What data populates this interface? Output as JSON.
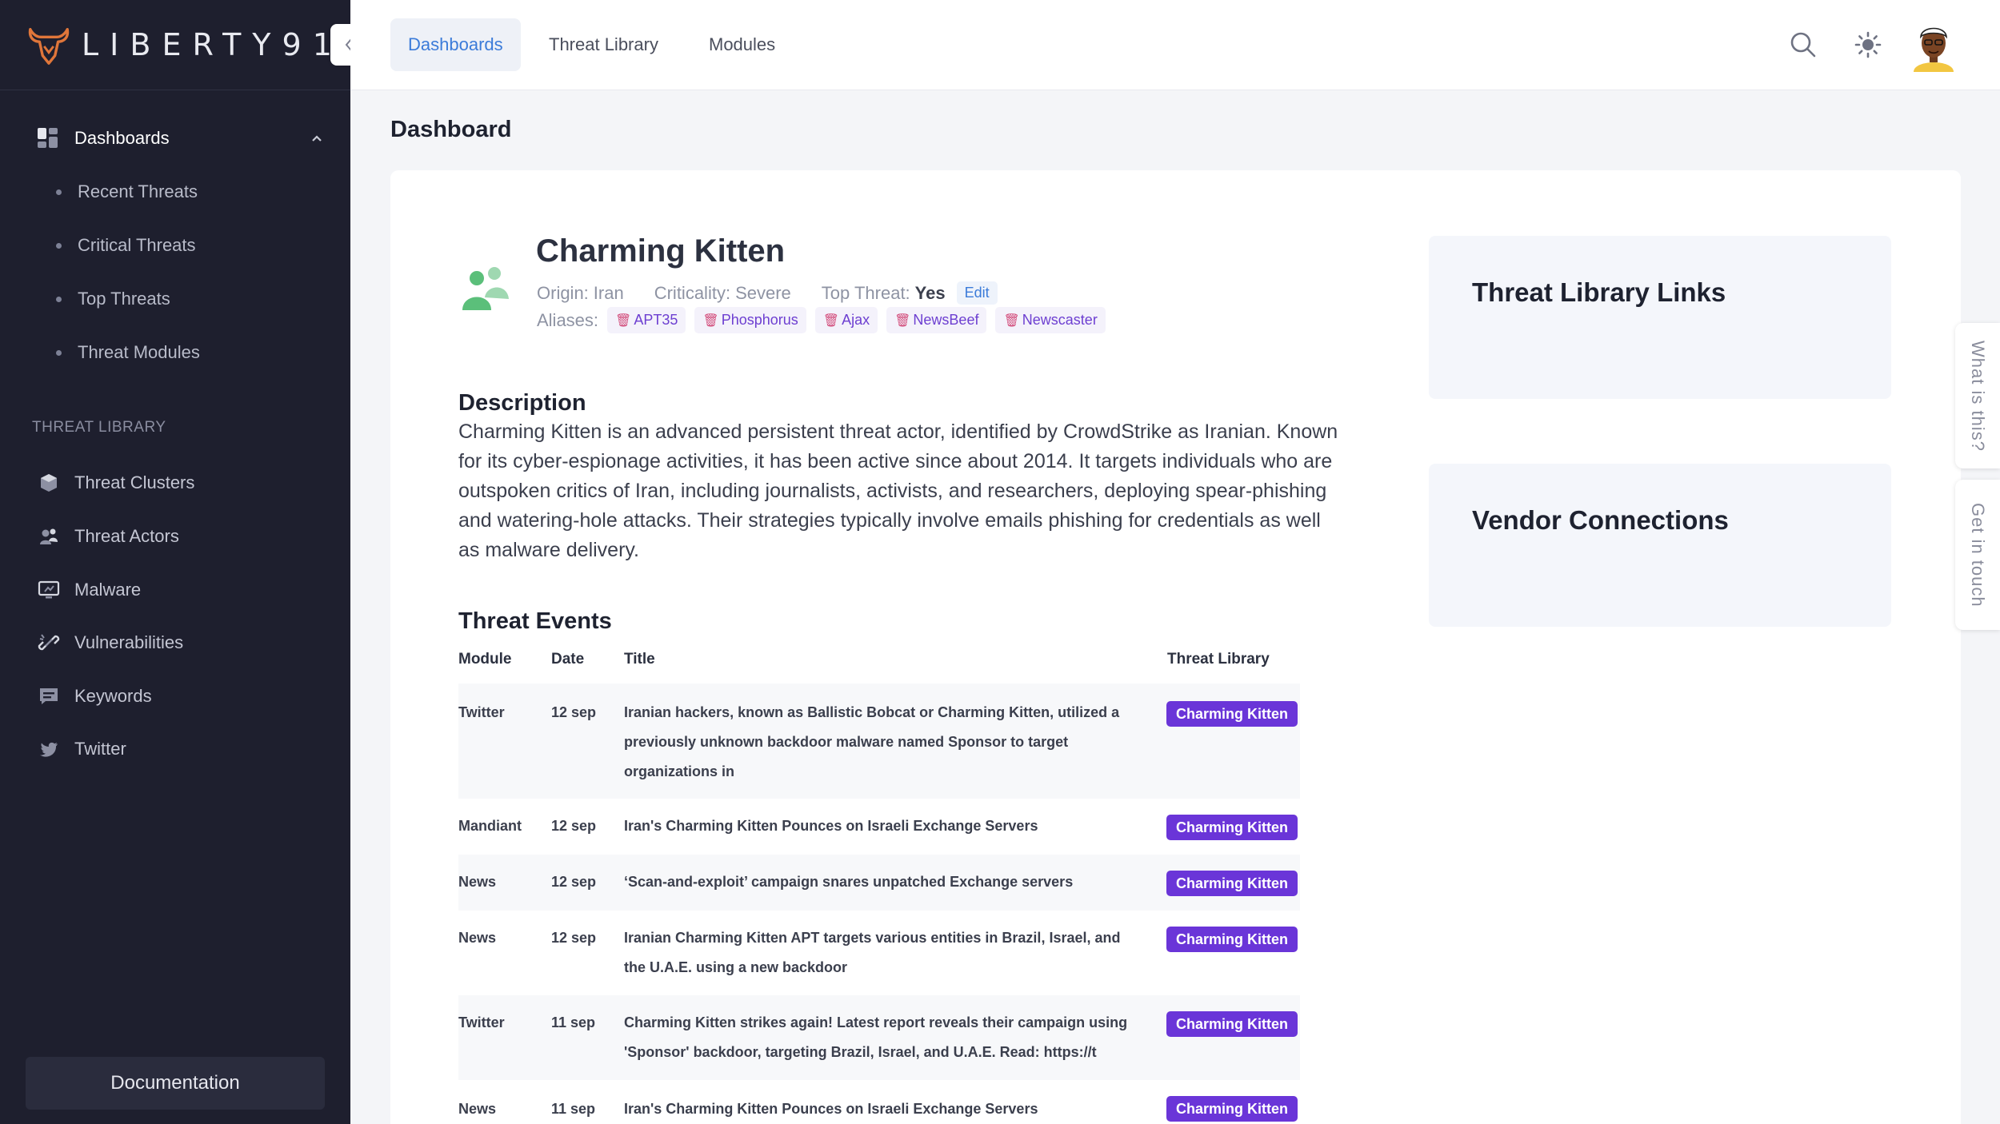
{
  "brand": {
    "name": "LIBERTY91"
  },
  "sidebar": {
    "dashboards_label": "Dashboards",
    "sub_items": [
      {
        "label": "Recent Threats"
      },
      {
        "label": "Critical Threats"
      },
      {
        "label": "Top Threats"
      },
      {
        "label": "Threat Modules"
      }
    ],
    "section_label": "THREAT LIBRARY",
    "library_items": [
      {
        "label": "Threat Clusters",
        "icon": "cube-icon"
      },
      {
        "label": "Threat Actors",
        "icon": "people-icon"
      },
      {
        "label": "Malware",
        "icon": "monitor-icon"
      },
      {
        "label": "Vulnerabilities",
        "icon": "broken-link-icon"
      },
      {
        "label": "Keywords",
        "icon": "message-icon"
      },
      {
        "label": "Twitter",
        "icon": "twitter-icon"
      }
    ],
    "documentation_label": "Documentation"
  },
  "topbar": {
    "tabs": [
      {
        "label": "Dashboards",
        "active": true
      },
      {
        "label": "Threat Library",
        "active": false
      },
      {
        "label": "Modules",
        "active": false
      }
    ]
  },
  "page": {
    "title": "Dashboard"
  },
  "actor": {
    "name": "Charming Kitten",
    "origin_label": "Origin:",
    "origin_value": "Iran",
    "criticality_label": "Criticality:",
    "criticality_value": "Severe",
    "top_threat_label": "Top Threat:",
    "top_threat_value": "Yes",
    "edit_label": "Edit",
    "aliases_label": "Aliases:",
    "aliases": [
      "APT35",
      "Phosphorus",
      "Ajax",
      "NewsBeef",
      "Newscaster"
    ]
  },
  "description": {
    "title": "Description",
    "text": "Charming Kitten is an advanced persistent threat actor, identified by CrowdStrike as Iranian. Known for its cyber-espionage activities, it has been active since about 2014. It targets individuals who are outspoken critics of Iran, including journalists, activists, and researchers, deploying spear-phishing and watering-hole attacks. Their strategies typically involve emails phishing for credentials as well as malware delivery."
  },
  "events": {
    "title": "Threat Events",
    "headers": {
      "module": "Module",
      "date": "Date",
      "title": "Title",
      "library": "Threat Library"
    },
    "rows": [
      {
        "module": "Twitter",
        "date": "12 sep",
        "title": "Iranian hackers, known as Ballistic Bobcat or Charming Kitten, utilized a previously unknown backdoor malware named Sponsor to target organizations in",
        "library": "Charming Kitten"
      },
      {
        "module": "Mandiant",
        "date": "12 sep",
        "title": "Iran's Charming Kitten Pounces on Israeli Exchange Servers",
        "library": "Charming Kitten"
      },
      {
        "module": "News",
        "date": "12 sep",
        "title": "‘Scan-and-exploit’ campaign snares unpatched Exchange servers",
        "library": "Charming Kitten"
      },
      {
        "module": "News",
        "date": "12 sep",
        "title": "Iranian Charming Kitten APT targets various entities in Brazil, Israel, and the U.A.E. using a new backdoor",
        "library": "Charming Kitten"
      },
      {
        "module": "Twitter",
        "date": "11 sep",
        "title": "Charming Kitten strikes again! Latest report reveals their campaign using 'Sponsor' backdoor, targeting Brazil, Israel, and U.A.E. Read: https://t",
        "library": "Charming Kitten"
      },
      {
        "module": "News",
        "date": "11 sep",
        "title": "Iran's Charming Kitten Pounces on Israeli Exchange Servers",
        "library": "Charming Kitten"
      }
    ]
  },
  "panels": {
    "links_title": "Threat Library Links",
    "vendors_title": "Vendor Connections"
  },
  "floating": {
    "what_is_this": "What is this?",
    "get_in_touch": "Get in touch"
  },
  "colors": {
    "sidebar_bg": "#1e1f2e",
    "accent_blue": "#3b7bd9",
    "pill_purple": "#6a35d8",
    "brand_orange": "#e0763a",
    "actor_green": "#5bbf7a"
  }
}
